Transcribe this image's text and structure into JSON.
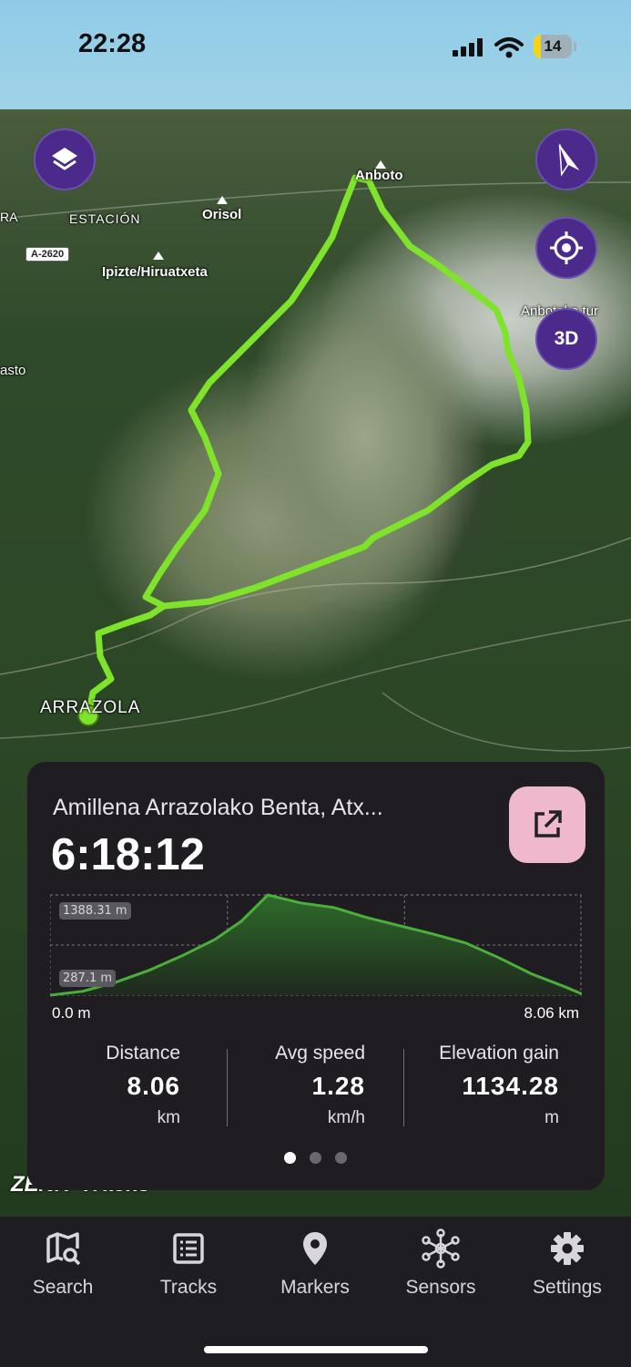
{
  "status_bar": {
    "time": "22:28",
    "battery": "14"
  },
  "map": {
    "labels": {
      "anboto": "Anboto",
      "estacion": "ESTACIÓN",
      "orisol": "Orisol",
      "road": "A-2620",
      "ipizte": "Ipizte/Hiruatxeta",
      "ra": "RA",
      "asto": "asto",
      "anbotoko": "Anbotoko tur",
      "arrazola": "ARRAZOLA"
    },
    "buttons": {
      "layers_icon": "layers-icon",
      "compass_icon": "compass-icon",
      "locate_icon": "locate-icon",
      "mode_3d": "3D"
    },
    "track_color": "#7fe22b"
  },
  "track_card": {
    "title": "Amillena Arrazolako Benta, Atx...",
    "duration": "6:18:12",
    "chart_data": {
      "type": "area",
      "x": [
        0,
        0.5,
        1.0,
        1.5,
        2.0,
        2.5,
        2.9,
        3.3,
        3.8,
        4.3,
        4.8,
        5.3,
        5.8,
        6.3,
        6.8,
        7.3,
        7.8,
        8.06
      ],
      "values": [
        287,
        330,
        430,
        560,
        720,
        900,
        1100,
        1388,
        1300,
        1250,
        1140,
        1050,
        960,
        860,
        700,
        520,
        380,
        300
      ],
      "x_unit": "km",
      "y_unit": "m",
      "y_labels": [
        "1388.31 m",
        "287.1 m"
      ],
      "x_labels": [
        "0.0 m",
        "8.06 km"
      ],
      "ylim": [
        287.1,
        1388.31
      ],
      "xlim": [
        0,
        8.06
      ],
      "grid": true,
      "line_color": "#4caf3a"
    },
    "stats": [
      {
        "label": "Distance",
        "value": "8.06",
        "unit": "km"
      },
      {
        "label": "Avg speed",
        "value": "1.28",
        "unit": "km/h"
      },
      {
        "label": "Elevation gain",
        "value": "1134.28",
        "unit": "m"
      }
    ],
    "page_indicator": {
      "count": 3,
      "active": 0
    }
  },
  "brand": "ZENIT Tracks",
  "nav": [
    {
      "label": "Search",
      "icon": "map-search-icon"
    },
    {
      "label": "Tracks",
      "icon": "list-icon"
    },
    {
      "label": "Markers",
      "icon": "pin-icon"
    },
    {
      "label": "Sensors",
      "icon": "sensors-icon"
    },
    {
      "label": "Settings",
      "icon": "gear-icon"
    }
  ]
}
